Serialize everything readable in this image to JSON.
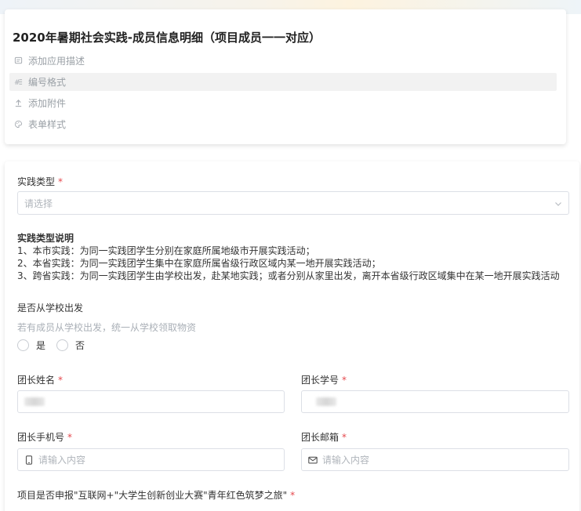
{
  "header": {
    "title": "2020年暑期社会实践-成员信息明细（项目成员一一对应）",
    "items": [
      {
        "label": "添加应用描述",
        "icon": "description-icon"
      },
      {
        "label": "编号格式",
        "icon": "number-format-icon"
      },
      {
        "label": "添加附件",
        "icon": "upload-icon"
      },
      {
        "label": "表单样式",
        "icon": "palette-icon"
      }
    ]
  },
  "form": {
    "practice_type": {
      "label": "实践类型",
      "required_mark": "*",
      "placeholder": "请选择"
    },
    "practice_desc": {
      "title": "实践类型说明",
      "lines": [
        "1、本市实践：为同一实践团学生分别在家庭所属地级市开展实践活动；",
        "2、本省实践：为同一实践团学生集中在家庭所属省级行政区域内某一地开展实践活动；",
        "3、跨省实践：为同一实践团学生由学校出发，赴某地实践；或者分别从家里出发，离开本省级行政区域集中在某一地开展实践活动"
      ]
    },
    "from_school": {
      "label": "是否从学校出发",
      "hint": "若有成员从学校出发，统一从学校领取物资",
      "options": [
        "是",
        "否"
      ]
    },
    "leader_name": {
      "label": "团长姓名",
      "required_mark": "*"
    },
    "leader_id": {
      "label": "团长学号",
      "required_mark": "*"
    },
    "leader_phone": {
      "label": "团长手机号",
      "required_mark": "*",
      "placeholder": "请输入内容"
    },
    "leader_email": {
      "label": "团长邮箱",
      "required_mark": "*",
      "placeholder": "请输入内容"
    },
    "project_declare": {
      "label": "项目是否申报\"互联网+\"大学生创新创业大赛\"青年红色筑梦之旅\"",
      "required_mark": "*"
    }
  },
  "colors": {
    "required": "#e5484d",
    "border": "#dcdfe6",
    "placeholder": "#b0b5bb"
  }
}
